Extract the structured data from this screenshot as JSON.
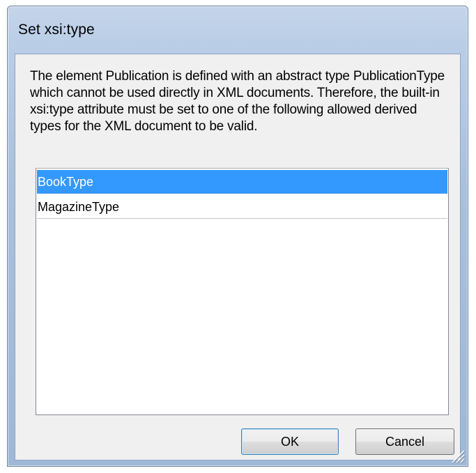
{
  "dialog": {
    "title": "Set xsi:type",
    "message": "The element Publication is defined with an abstract type PublicationType which cannot be used directly in XML documents. Therefore, the built-in xsi:type attribute must be set to one of the following allowed derived types for the XML document to be valid.",
    "types_list": [
      {
        "label": "BookType",
        "selected": true
      },
      {
        "label": "MagazineType",
        "selected": false
      }
    ],
    "ok_label": "OK",
    "cancel_label": "Cancel"
  },
  "colors": {
    "selection": "#3399ff",
    "frame": "#b9cde6",
    "client_background": "#f0f0f0"
  },
  "icons": {
    "resize_grip": "size-grip-icon"
  }
}
